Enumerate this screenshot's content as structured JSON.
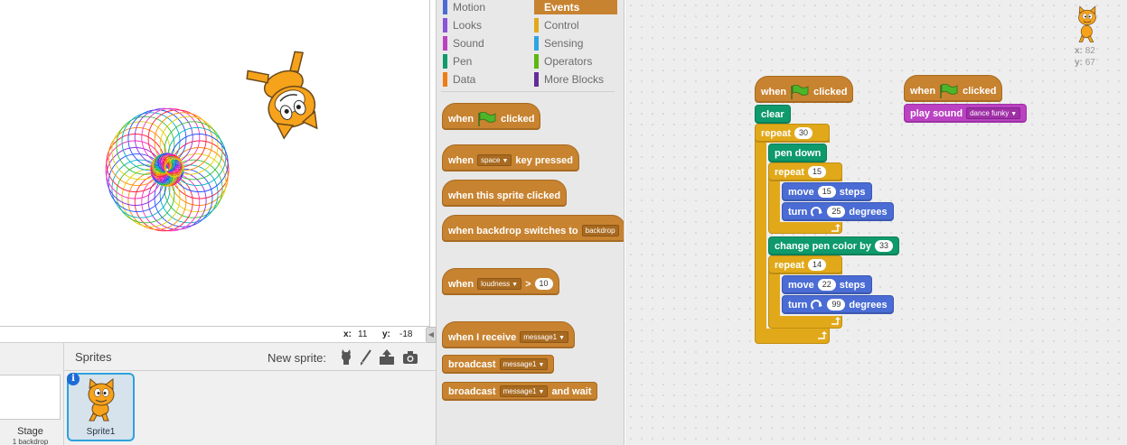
{
  "stage": {
    "mouse_x_label": "x:",
    "mouse_x": "11",
    "mouse_y_label": "y:",
    "mouse_y": "-18"
  },
  "sprite_pane": {
    "stage_label": "Stage",
    "backdrop_count": "1 backdrop",
    "sprites_title": "Sprites",
    "new_sprite_label": "New sprite:",
    "sprite1_name": "Sprite1",
    "info_badge": "i"
  },
  "categories": [
    {
      "label": "Motion",
      "color": "#4a6cd4"
    },
    {
      "label": "Looks",
      "color": "#8a55d7"
    },
    {
      "label": "Sound",
      "color": "#bb42c3"
    },
    {
      "label": "Pen",
      "color": "#0e9a6c"
    },
    {
      "label": "Data",
      "color": "#ee7d16"
    },
    {
      "label": "Events",
      "color": "#c88330",
      "selected": true
    },
    {
      "label": "Control",
      "color": "#e1a91a"
    },
    {
      "label": "Sensing",
      "color": "#2ca5e2"
    },
    {
      "label": "Operators",
      "color": "#5cb712"
    },
    {
      "label": "More Blocks",
      "color": "#632d99"
    }
  ],
  "palette": {
    "when": "when",
    "clicked": "clicked",
    "space_key": "space",
    "key_pressed": "key pressed",
    "when_this_sprite_clicked": "when this sprite clicked",
    "when_backdrop_switches_to": "when backdrop switches to",
    "backdrop": "backdrop",
    "loudness": "loudness",
    "gt": ">",
    "loudness_value": "10",
    "when_i_receive": "when I receive",
    "message1": "message1",
    "broadcast": "broadcast",
    "and_wait": "and wait"
  },
  "scripts": {
    "sprite_x_label": "x:",
    "sprite_x": "82",
    "sprite_y_label": "y:",
    "sprite_y": "67",
    "when": "when",
    "clicked": "clicked",
    "clear": "clear",
    "repeat": "repeat",
    "repeat_outer": "30",
    "pen_down": "pen down",
    "repeat_inner1": "15",
    "move": "move",
    "steps": "steps",
    "move1": "15",
    "turn": "turn",
    "degrees": "degrees",
    "turn1": "25",
    "change_pen_color_by": "change pen color by",
    "color_delta": "33",
    "repeat_inner2": "14",
    "move2": "22",
    "turn2": "99",
    "play_sound": "play sound",
    "sound_name": "dance funky"
  },
  "icons": [
    "flag-icon",
    "paint-brush-icon",
    "upload-icon",
    "camera-icon",
    "sprite-library-icon",
    "turn-right-icon",
    "info-icon",
    "cat-sprite-icon"
  ]
}
